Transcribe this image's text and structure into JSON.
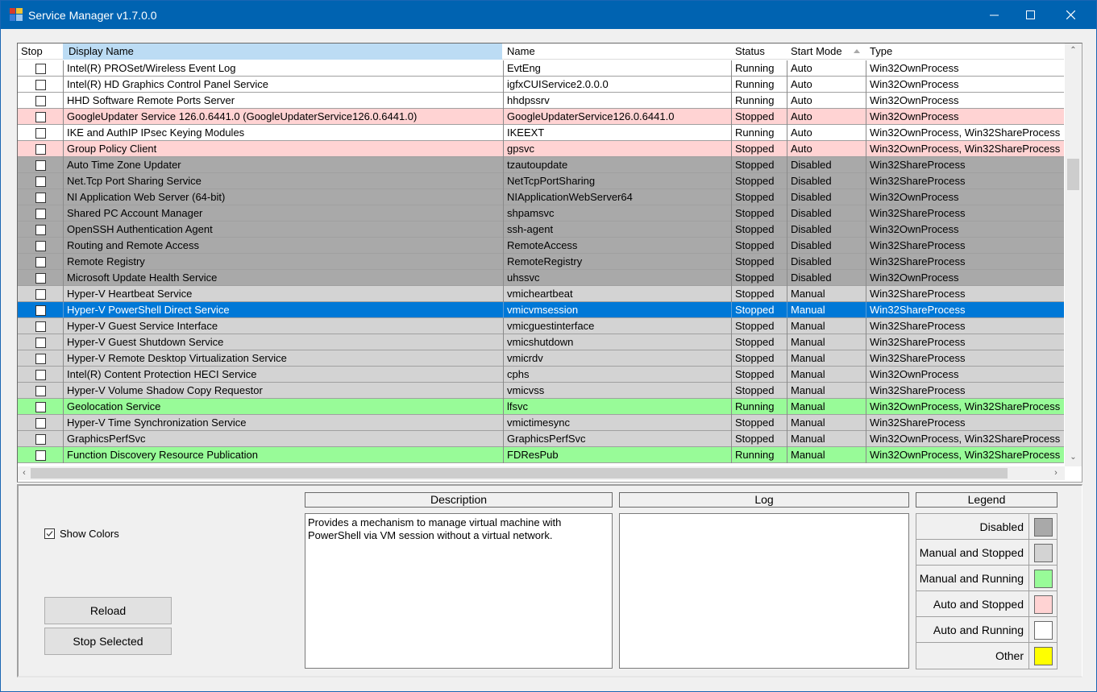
{
  "window": {
    "title": "Service Manager v1.7.0.0",
    "icon": "app-window-icon",
    "controls": {
      "minimize": "—",
      "maximize": "☐",
      "close": "✕"
    }
  },
  "grid": {
    "columns": [
      {
        "key": "stop",
        "label": "Stop"
      },
      {
        "key": "display_name",
        "label": "Display Name"
      },
      {
        "key": "name",
        "label": "Name"
      },
      {
        "key": "status",
        "label": "Status"
      },
      {
        "key": "start_mode",
        "label": "Start Mode",
        "sorted": "ascending"
      },
      {
        "key": "type",
        "label": "Type"
      }
    ],
    "selected_row_index": 15,
    "rows": [
      {
        "display_name": "Intel(R) PROSet/Wireless Event Log",
        "name": "EvtEng",
        "status": "Running",
        "start_mode": "Auto",
        "type": "Win32OwnProcess",
        "category": "auto_running",
        "checked": false
      },
      {
        "display_name": "Intel(R) HD Graphics Control Panel Service",
        "name": "igfxCUIService2.0.0.0",
        "status": "Running",
        "start_mode": "Auto",
        "type": "Win32OwnProcess",
        "category": "auto_running",
        "checked": false
      },
      {
        "display_name": "HHD Software Remote Ports Server",
        "name": "hhdpssrv",
        "status": "Running",
        "start_mode": "Auto",
        "type": "Win32OwnProcess",
        "category": "auto_running",
        "checked": false
      },
      {
        "display_name": "GoogleUpdater Service 126.0.6441.0 (GoogleUpdaterService126.0.6441.0)",
        "name": "GoogleUpdaterService126.0.6441.0",
        "status": "Stopped",
        "start_mode": "Auto",
        "type": "Win32OwnProcess",
        "category": "auto_stopped",
        "checked": false
      },
      {
        "display_name": "IKE and AuthIP IPsec Keying Modules",
        "name": "IKEEXT",
        "status": "Running",
        "start_mode": "Auto",
        "type": "Win32OwnProcess, Win32ShareProcess",
        "category": "auto_running",
        "checked": false
      },
      {
        "display_name": "Group Policy Client",
        "name": "gpsvc",
        "status": "Stopped",
        "start_mode": "Auto",
        "type": "Win32OwnProcess, Win32ShareProcess",
        "category": "auto_stopped",
        "checked": false
      },
      {
        "display_name": "Auto Time Zone Updater",
        "name": "tzautoupdate",
        "status": "Stopped",
        "start_mode": "Disabled",
        "type": "Win32ShareProcess",
        "category": "disabled",
        "checked": false
      },
      {
        "display_name": "Net.Tcp Port Sharing Service",
        "name": "NetTcpPortSharing",
        "status": "Stopped",
        "start_mode": "Disabled",
        "type": "Win32ShareProcess",
        "category": "disabled",
        "checked": false
      },
      {
        "display_name": "NI Application Web Server (64-bit)",
        "name": "NIApplicationWebServer64",
        "status": "Stopped",
        "start_mode": "Disabled",
        "type": "Win32OwnProcess",
        "category": "disabled",
        "checked": false
      },
      {
        "display_name": "Shared PC Account Manager",
        "name": "shpamsvc",
        "status": "Stopped",
        "start_mode": "Disabled",
        "type": "Win32ShareProcess",
        "category": "disabled",
        "checked": false
      },
      {
        "display_name": "OpenSSH Authentication Agent",
        "name": "ssh-agent",
        "status": "Stopped",
        "start_mode": "Disabled",
        "type": "Win32OwnProcess",
        "category": "disabled",
        "checked": false
      },
      {
        "display_name": "Routing and Remote Access",
        "name": "RemoteAccess",
        "status": "Stopped",
        "start_mode": "Disabled",
        "type": "Win32ShareProcess",
        "category": "disabled",
        "checked": false
      },
      {
        "display_name": "Remote Registry",
        "name": "RemoteRegistry",
        "status": "Stopped",
        "start_mode": "Disabled",
        "type": "Win32ShareProcess",
        "category": "disabled",
        "checked": false
      },
      {
        "display_name": "Microsoft Update Health Service",
        "name": "uhssvc",
        "status": "Stopped",
        "start_mode": "Disabled",
        "type": "Win32OwnProcess",
        "category": "disabled",
        "checked": false
      },
      {
        "display_name": "Hyper-V Heartbeat Service",
        "name": "vmicheartbeat",
        "status": "Stopped",
        "start_mode": "Manual",
        "type": "Win32ShareProcess",
        "category": "manual_stopped",
        "checked": false
      },
      {
        "display_name": "Hyper-V PowerShell Direct Service",
        "name": "vmicvmsession",
        "status": "Stopped",
        "start_mode": "Manual",
        "type": "Win32ShareProcess",
        "category": "manual_stopped",
        "checked": false
      },
      {
        "display_name": "Hyper-V Guest Service Interface",
        "name": "vmicguestinterface",
        "status": "Stopped",
        "start_mode": "Manual",
        "type": "Win32ShareProcess",
        "category": "manual_stopped",
        "checked": false
      },
      {
        "display_name": "Hyper-V Guest Shutdown Service",
        "name": "vmicshutdown",
        "status": "Stopped",
        "start_mode": "Manual",
        "type": "Win32ShareProcess",
        "category": "manual_stopped",
        "checked": false
      },
      {
        "display_name": "Hyper-V Remote Desktop Virtualization Service",
        "name": "vmicrdv",
        "status": "Stopped",
        "start_mode": "Manual",
        "type": "Win32ShareProcess",
        "category": "manual_stopped",
        "checked": false
      },
      {
        "display_name": "Intel(R) Content Protection HECI Service",
        "name": "cphs",
        "status": "Stopped",
        "start_mode": "Manual",
        "type": "Win32OwnProcess",
        "category": "manual_stopped",
        "checked": false
      },
      {
        "display_name": "Hyper-V Volume Shadow Copy Requestor",
        "name": "vmicvss",
        "status": "Stopped",
        "start_mode": "Manual",
        "type": "Win32ShareProcess",
        "category": "manual_stopped",
        "checked": false
      },
      {
        "display_name": "Geolocation Service",
        "name": "lfsvc",
        "status": "Running",
        "start_mode": "Manual",
        "type": "Win32OwnProcess, Win32ShareProcess",
        "category": "manual_running",
        "checked": false
      },
      {
        "display_name": "Hyper-V Time Synchronization Service",
        "name": "vmictimesync",
        "status": "Stopped",
        "start_mode": "Manual",
        "type": "Win32ShareProcess",
        "category": "manual_stopped",
        "checked": false
      },
      {
        "display_name": "GraphicsPerfSvc",
        "name": "GraphicsPerfSvc",
        "status": "Stopped",
        "start_mode": "Manual",
        "type": "Win32OwnProcess, Win32ShareProcess",
        "category": "manual_stopped",
        "checked": false
      },
      {
        "display_name": "Function Discovery Resource Publication",
        "name": "FDResPub",
        "status": "Running",
        "start_mode": "Manual",
        "type": "Win32OwnProcess, Win32ShareProcess",
        "category": "manual_running",
        "checked": false
      }
    ]
  },
  "colors": {
    "disabled": "#a9a9a9",
    "manual_stopped": "#d3d3d3",
    "manual_running": "#98fb98",
    "auto_stopped": "#ffd3d3",
    "auto_running": "#ffffff",
    "other": "#ffff00",
    "selection": "#0078d7",
    "titlebar": "#0063b1"
  },
  "bottom": {
    "show_colors": {
      "label": "Show Colors",
      "checked": true
    },
    "reload_label": "Reload",
    "stop_selected_label": "Stop Selected",
    "description_label": "Description",
    "description_text": "Provides a mechanism to manage virtual machine with\nPowerShell via VM session without a virtual network.",
    "log_label": "Log",
    "log_text": "",
    "legend_label": "Legend",
    "legend": [
      {
        "label": "Disabled",
        "key": "disabled"
      },
      {
        "label": "Manual and Stopped",
        "key": "manual_stopped"
      },
      {
        "label": "Manual and Running",
        "key": "manual_running"
      },
      {
        "label": "Auto and Stopped",
        "key": "auto_stopped"
      },
      {
        "label": "Auto and Running",
        "key": "auto_running"
      },
      {
        "label": "Other",
        "key": "other"
      }
    ]
  }
}
